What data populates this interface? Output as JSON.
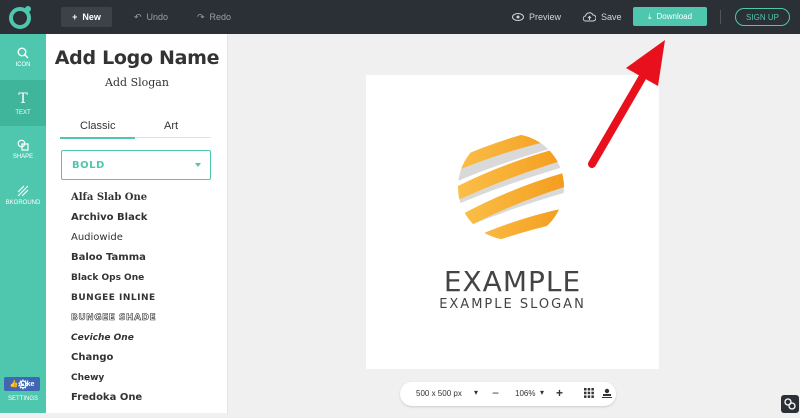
{
  "toolbar": {
    "new_label": "New",
    "undo_label": "Undo",
    "redo_label": "Redo",
    "preview_label": "Preview",
    "save_label": "Save",
    "download_label": "Download",
    "signup_label": "SIGN UP"
  },
  "rail": {
    "items": [
      {
        "label": "ICON",
        "icon": "search-icon"
      },
      {
        "label": "TEXT",
        "icon": "text-icon"
      },
      {
        "label": "SHAPE",
        "icon": "shape-icon"
      },
      {
        "label": "BKGROUND",
        "icon": "background-icon"
      }
    ],
    "like_label": "Like",
    "settings_label": "SETTINGS"
  },
  "panel": {
    "title": "Add Logo Name",
    "slogan": "Add Slogan",
    "tabs": [
      "Classic",
      "Art"
    ],
    "select_value": "BOLD",
    "fonts": [
      "Alfa Slab One",
      "Archivo Black",
      "Audiowide",
      "Baloo Tamma",
      "Black Ops One",
      "BUNGEE INLINE",
      "BUNGEE SHADE",
      "Ceviche One",
      "Chango",
      "Chewy",
      "Fredoka One"
    ]
  },
  "canvas": {
    "name": "EXAMPLE",
    "slogan": "EXAMPLE SLOGAN"
  },
  "zoombar": {
    "size": "500 x 500 px",
    "zoom": "106%"
  },
  "colors": {
    "accent": "#4fc7ae",
    "topbar": "#2b2f36",
    "arrow": "#e8101c",
    "orange": "#f7a823"
  }
}
